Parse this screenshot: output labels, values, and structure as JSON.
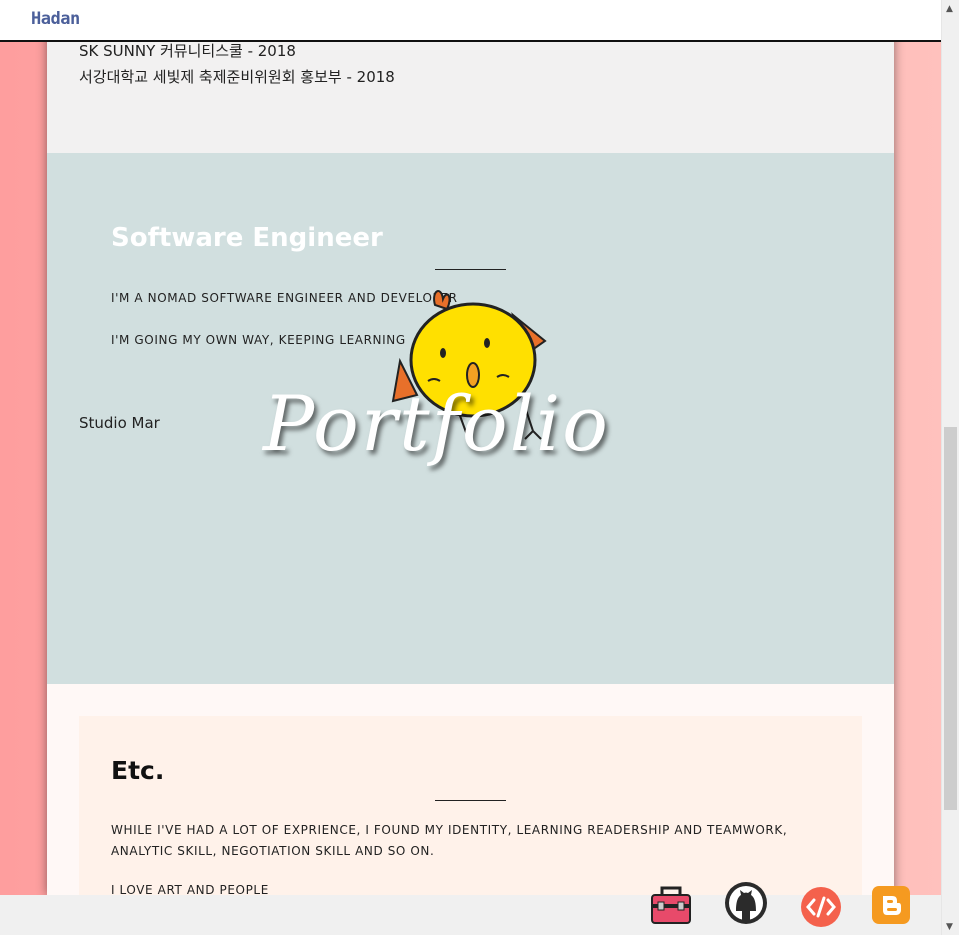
{
  "brand": {
    "logo": "Hadan"
  },
  "education": [
    "SK SUNNY 커뮤니티스쿨 - 2018",
    "서강대학교 세빛제 축제준비위원회 홍보부 - 2018"
  ],
  "software_section": {
    "title": "Software Engineer",
    "line1": "I'M A NOMAD SOFTWARE ENGINEER AND DEVELOPER",
    "line2": "I'M GOING MY OWN WAY, KEEPING LEARNING",
    "studio": "Studio Mar"
  },
  "overlay": {
    "word": "Portfolio"
  },
  "etc_section": {
    "title": "Etc.",
    "text": "WHILE I'VE HAD A LOT OF EXPRIENCE, I FOUND MY IDENTITY, LEARNING READERSHIP AND TEAMWORK, ANALYTIC SKILL, NEGOTIATION SKILL AND SO ON.",
    "text2": "I LOVE ART AND PEOPLE"
  },
  "bottom_icons": [
    "toolbox-icon",
    "github-icon",
    "code-icon",
    "blogger-icon"
  ],
  "colors": {
    "background_left": "#fe9e9e",
    "background_right": "#ffc1bd",
    "software_bg": "#d1dfdf",
    "etc_bg": "#fff2ea",
    "logo": "#4b5f9a"
  }
}
